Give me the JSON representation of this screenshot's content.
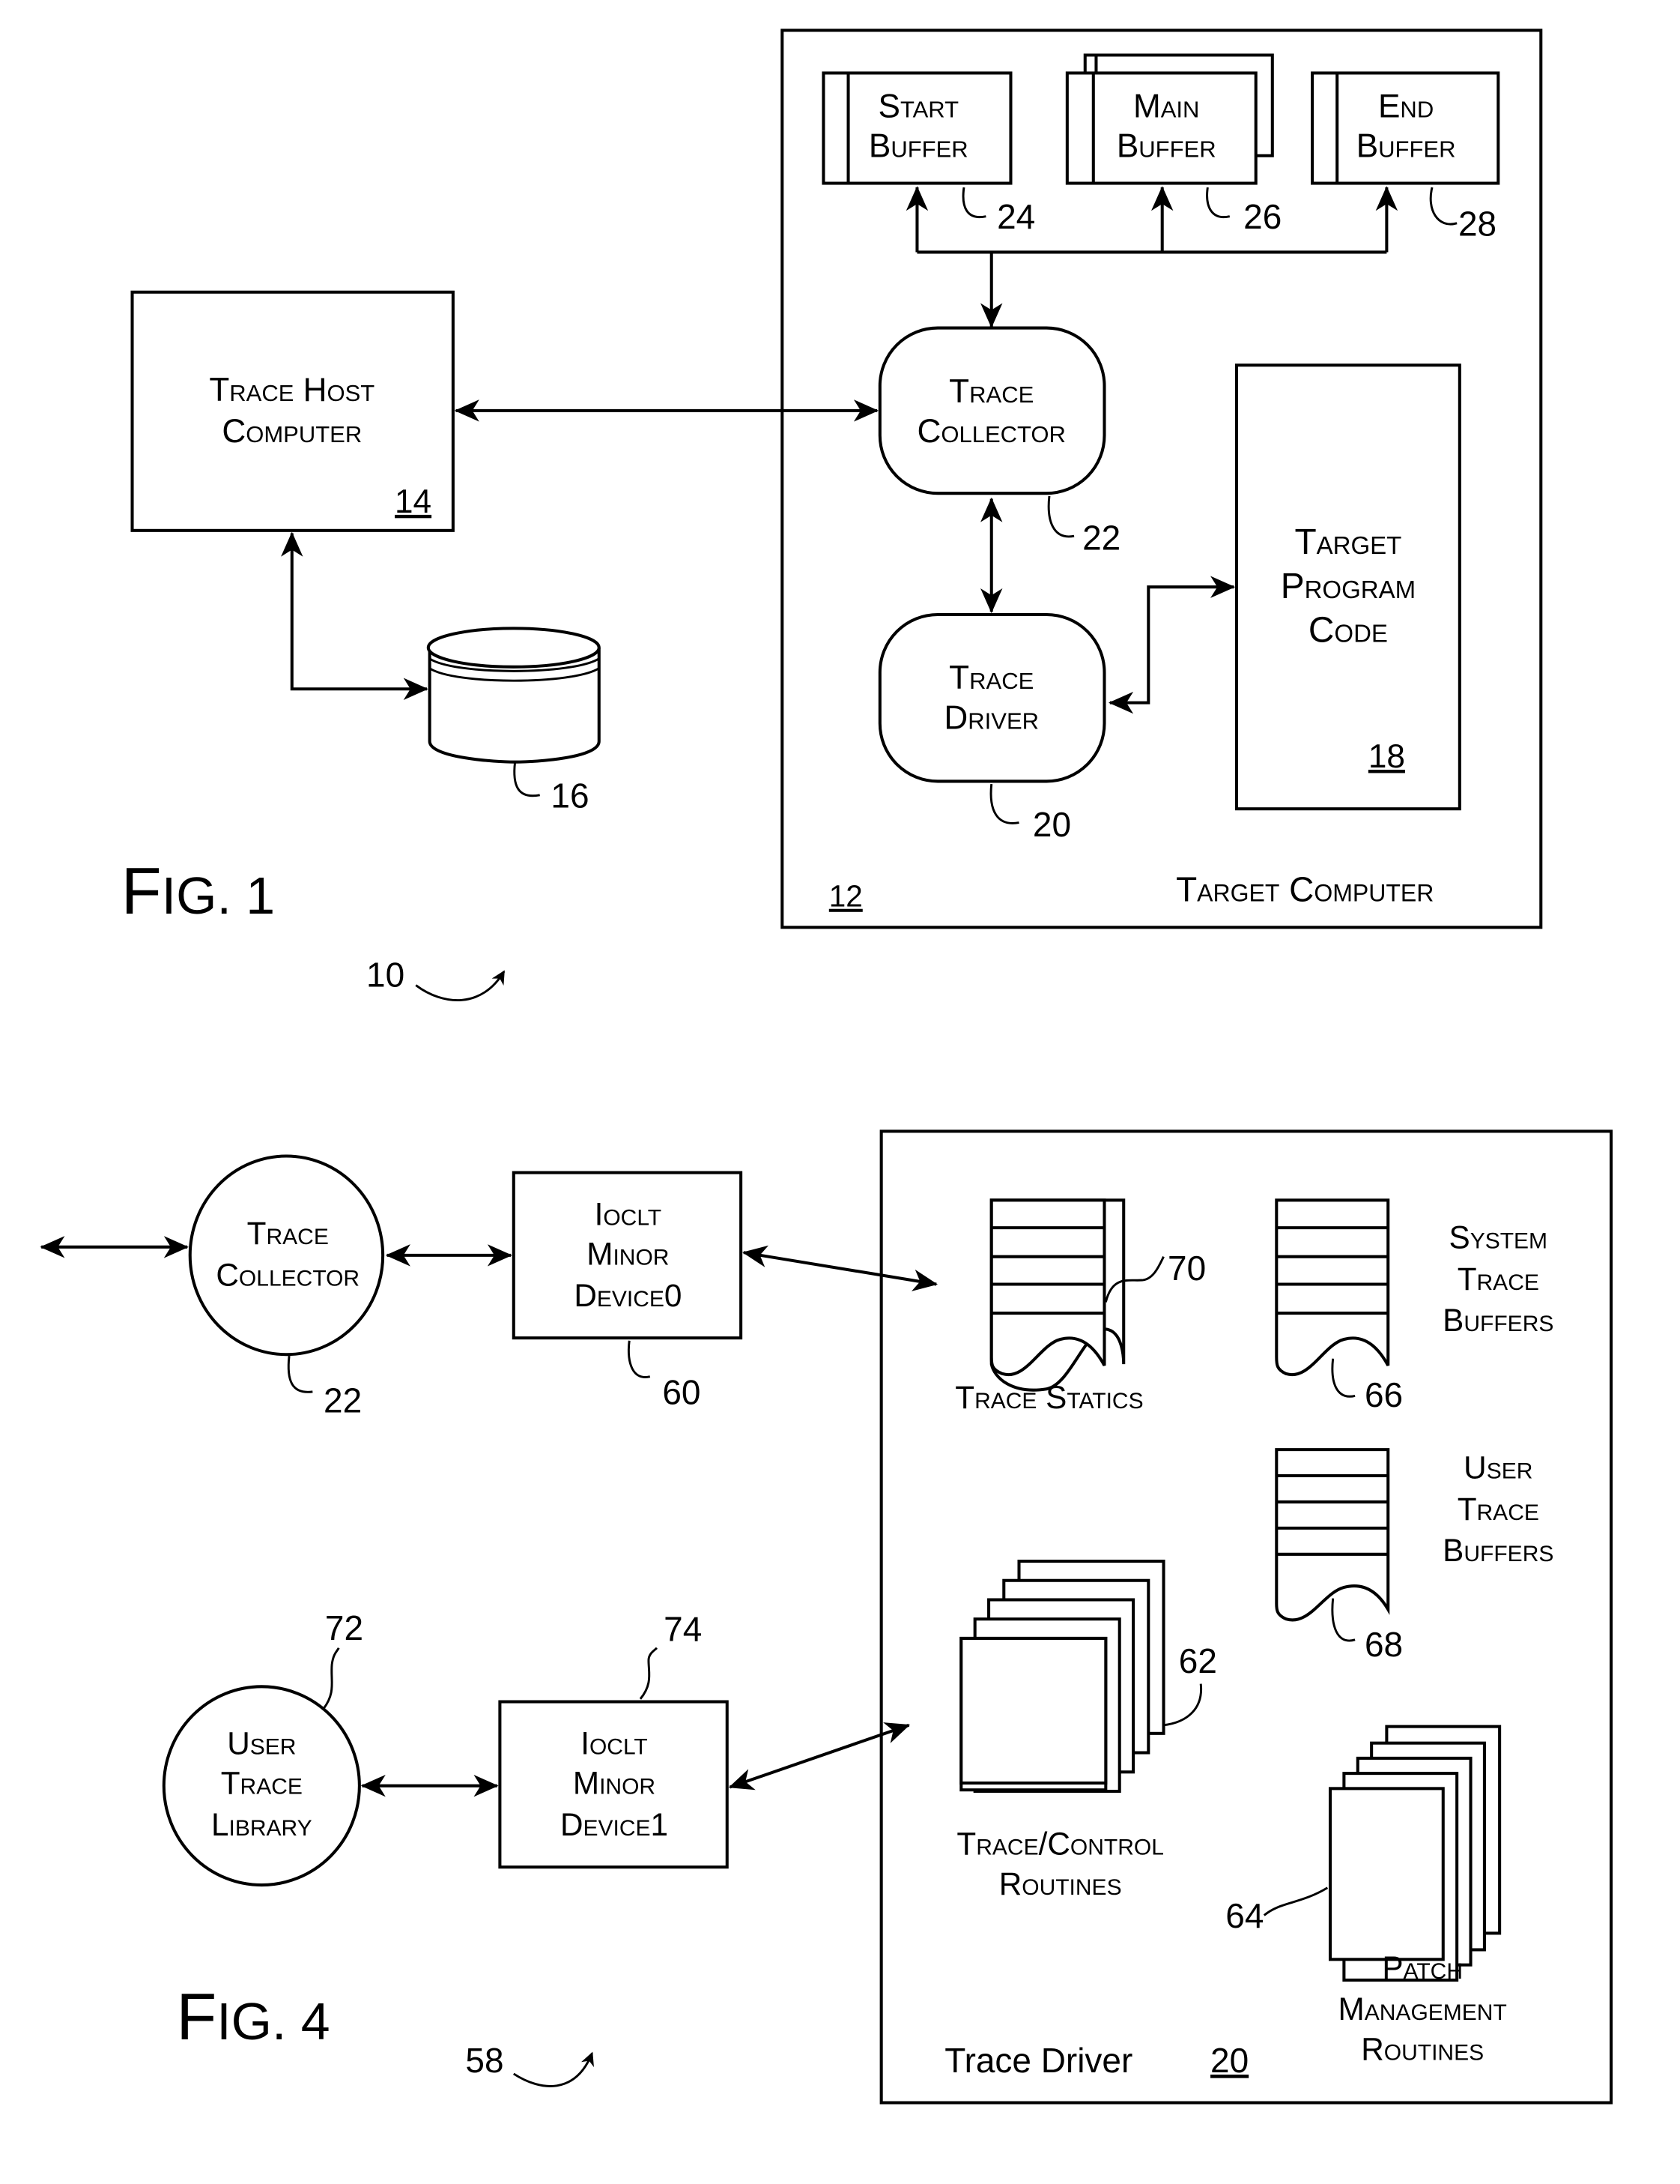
{
  "fig1": {
    "caption_prefix": "F",
    "caption_rest": "IG. 1",
    "ref": "10",
    "target_computer": {
      "label": "Target Computer",
      "ref": "12"
    },
    "trace_host": {
      "line1": "Trace Host",
      "line2": "Computer",
      "ref": "14"
    },
    "storage": {
      "ref": "16"
    },
    "target_program": {
      "line1": "Target",
      "line2": "Program",
      "line3": "Code",
      "ref": "18"
    },
    "trace_driver": {
      "line1": "Trace",
      "line2": "Driver",
      "ref": "20"
    },
    "trace_collector": {
      "line1": "Trace",
      "line2": "Collector",
      "ref": "22"
    },
    "buffers": [
      {
        "line1": "Start",
        "line2": "Buffer",
        "ref": "24"
      },
      {
        "line1": "Main",
        "line2": "Buffer",
        "ref": "26"
      },
      {
        "line1": "End",
        "line2": "Buffer",
        "ref": "28"
      }
    ]
  },
  "fig4": {
    "caption_prefix": "F",
    "caption_rest": "IG. 4",
    "ref": "58",
    "trace_collector": {
      "line1": "Trace",
      "line2": "Collector",
      "ref": "22"
    },
    "ioctl0": {
      "line1": "Ioclt",
      "line2": "Minor",
      "line3": "Device0",
      "ref": "60"
    },
    "user_trace_library": {
      "line1": "User",
      "line2": "Trace",
      "line3": "Library",
      "ref": "72"
    },
    "ioctl1": {
      "line1": "Ioclt",
      "line2": "Minor",
      "line3": "Device1",
      "ref": "74"
    },
    "trace_driver_box": {
      "label": "Trace Driver",
      "ref": "20"
    },
    "trace_statics": {
      "label": "Trace Statics",
      "ref": "70"
    },
    "system_trace_buffers": {
      "line1": "System",
      "line2": "Trace",
      "line3": "Buffers",
      "ref": "66"
    },
    "user_trace_buffers": {
      "line1": "User",
      "line2": "Trace",
      "line3": "Buffers",
      "ref": "68"
    },
    "trace_control_routines": {
      "line1": "Trace/Control",
      "line2": "Routines",
      "ref": "62"
    },
    "patch_management_routines": {
      "line1": "Patch",
      "line2": "Management",
      "line3": "Routines",
      "ref": "64"
    }
  }
}
